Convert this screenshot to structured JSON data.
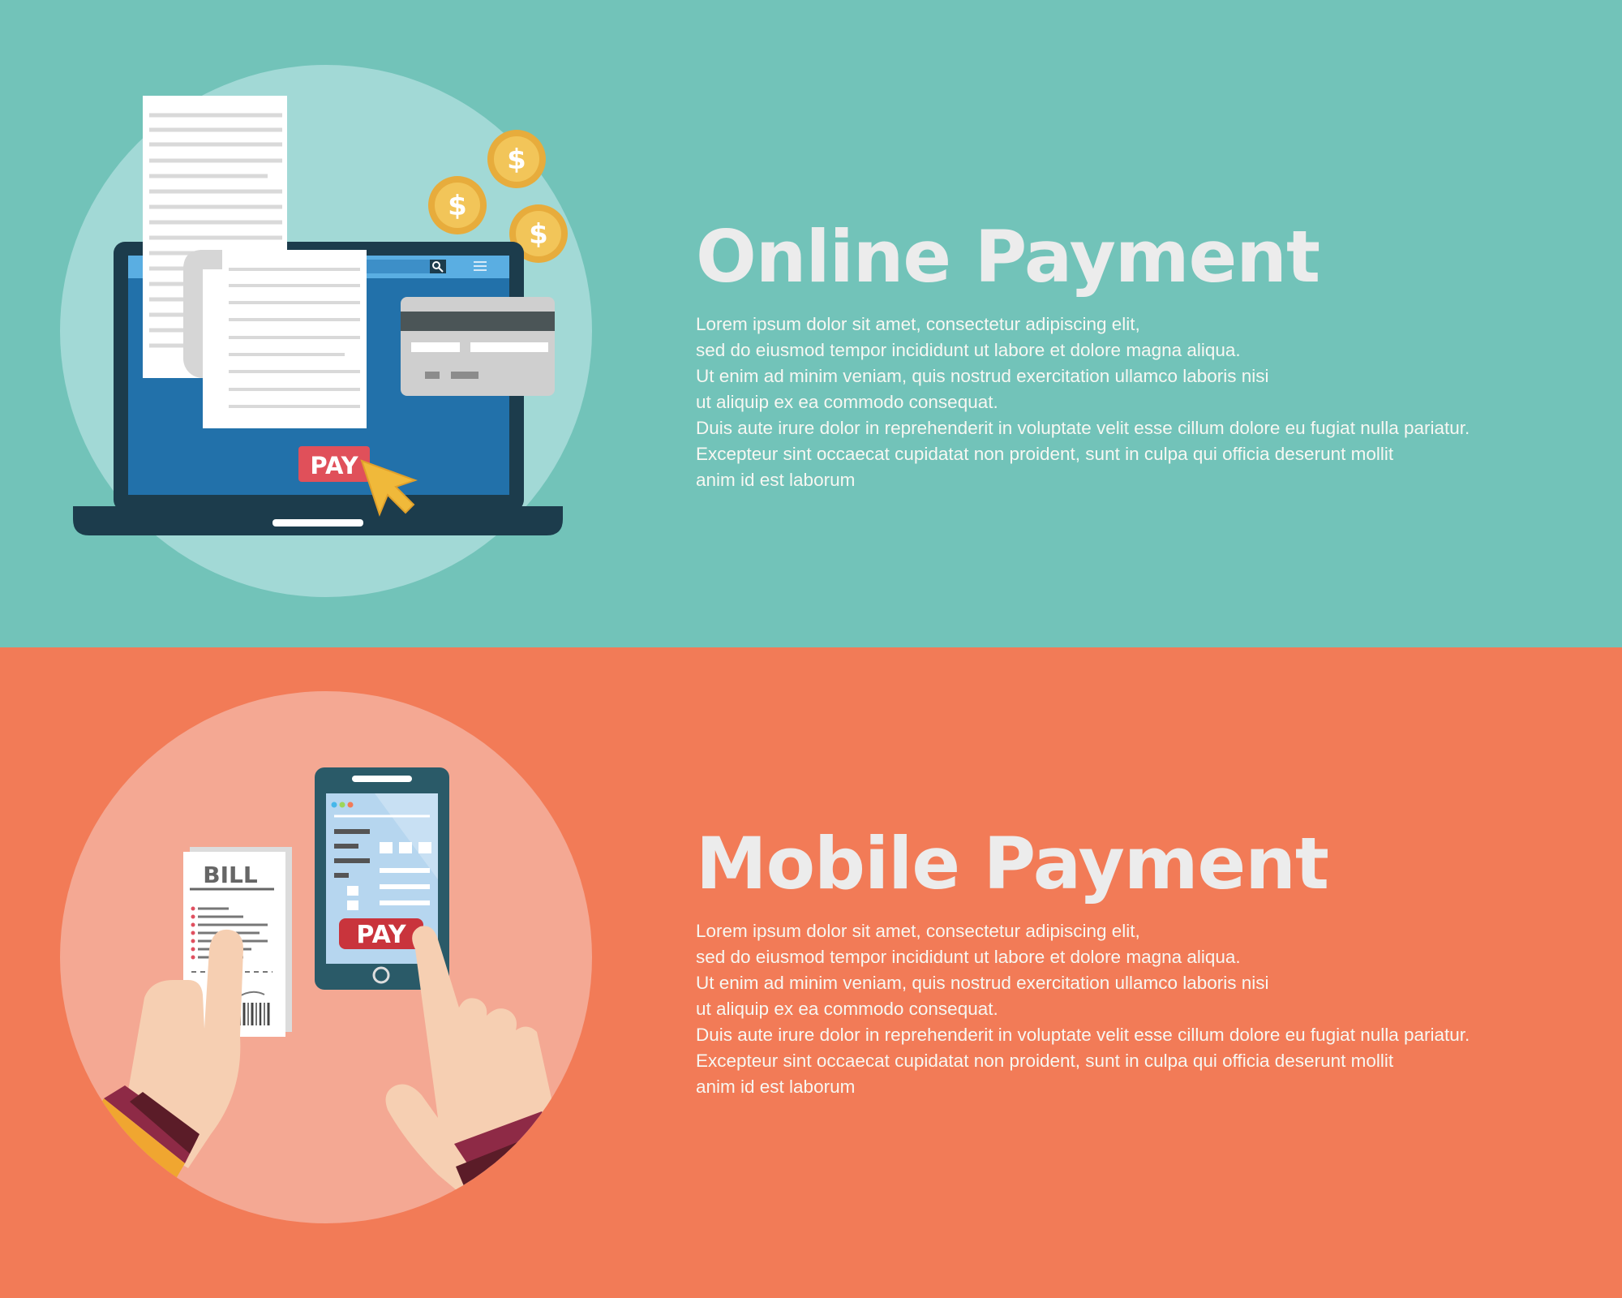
{
  "banners": [
    {
      "id": "online",
      "title": "Online Payment",
      "paragraph": [
        "Lorem ipsum dolor sit amet, consectetur adipiscing elit,",
        "sed do eiusmod tempor incididunt ut labore et dolore magna aliqua.",
        "Ut enim ad minim veniam, quis nostrud exercitation ullamco laboris nisi",
        "ut aliquip ex ea commodo consequat.",
        "Duis aute irure dolor in reprehenderit in voluptate velit esse cillum dolore eu fugiat nulla pariatur.",
        "Excepteur sint occaecat cupidatat non proident, sunt in culpa qui officia deserunt mollit",
        "anim id est laborum"
      ],
      "illustration": {
        "pay_label": "PAY",
        "coin_symbol": "$",
        "icons": [
          "laptop-icon",
          "receipt-icon",
          "credit-card-icon",
          "coin-icon",
          "cursor-arrow-icon",
          "search-icon",
          "menu-icon"
        ]
      },
      "colors": {
        "background": "#72c3b9",
        "circle": "#a2d9d6",
        "title": "#ececec",
        "text": "#f7f7f2"
      }
    },
    {
      "id": "mobile",
      "title": "Mobile Payment",
      "paragraph": [
        "Lorem ipsum dolor sit amet, consectetur adipiscing elit,",
        "sed do eiusmod tempor incididunt ut labore et dolore magna aliqua.",
        "Ut enim ad minim veniam, quis nostrud exercitation ullamco laboris nisi",
        "ut aliquip ex ea commodo consequat.",
        "Duis aute irure dolor in reprehenderit in voluptate velit esse cillum dolore eu fugiat nulla pariatur.",
        "Excepteur sint occaecat cupidatat non proident, sunt in culpa qui officia deserunt mollit",
        "anim id est laborum"
      ],
      "illustration": {
        "pay_label": "PAY",
        "bill_label": "BILL",
        "icons": [
          "smartphone-icon",
          "bill-receipt-icon",
          "hand-icon",
          "barcode-icon"
        ]
      },
      "colors": {
        "background": "#f27b57",
        "circle": "#f4a893",
        "title": "#ececec",
        "text": "#f7f7f2"
      }
    }
  ]
}
